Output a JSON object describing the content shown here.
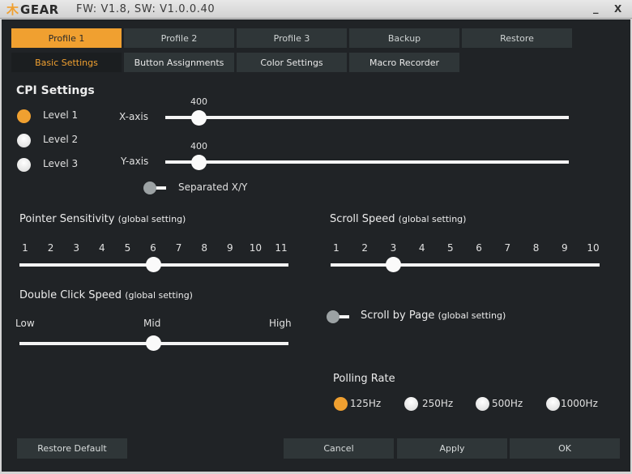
{
  "titlebar": {
    "logo_mark": "木",
    "logo_text": "GEAR",
    "version": "FW: V1.8, SW: V1.0.0.40",
    "minimize": "_",
    "close": "X"
  },
  "profile_tabs": [
    {
      "label": "Profile 1",
      "active": true
    },
    {
      "label": "Profile 2",
      "active": false
    },
    {
      "label": "Profile 3",
      "active": false
    },
    {
      "label": "Backup",
      "active": false
    },
    {
      "label": "Restore",
      "active": false
    }
  ],
  "sub_tabs": [
    {
      "label": "Basic Settings",
      "active": true
    },
    {
      "label": "Button Assignments",
      "active": false
    },
    {
      "label": "Color Settings",
      "active": false
    },
    {
      "label": "Macro Recorder",
      "active": false
    }
  ],
  "cpi": {
    "title": "CPI Settings",
    "levels": [
      {
        "label": "Level 1",
        "selected": true
      },
      {
        "label": "Level 2",
        "selected": false
      },
      {
        "label": "Level 3",
        "selected": false
      }
    ],
    "x_axis": {
      "label": "X-axis",
      "value": "400",
      "fraction": 0.08
    },
    "y_axis": {
      "label": "Y-axis",
      "value": "400",
      "fraction": 0.08
    },
    "separated_label": "Separated X/Y",
    "separated_on": false
  },
  "pointer": {
    "title": "Pointer Sensitivity",
    "note": "(global setting)",
    "ticks": [
      "1",
      "2",
      "3",
      "4",
      "5",
      "6",
      "7",
      "8",
      "9",
      "10",
      "11"
    ],
    "value": 6
  },
  "double_click": {
    "title": "Double Click Speed",
    "note": "(global setting)",
    "labels": {
      "low": "Low",
      "mid": "Mid",
      "high": "High"
    },
    "value": "Mid"
  },
  "scroll_speed": {
    "title": "Scroll Speed",
    "note": "(global setting)",
    "ticks": [
      "1",
      "2",
      "3",
      "4",
      "5",
      "6",
      "7",
      "8",
      "9",
      "10"
    ],
    "value": 3
  },
  "scroll_page": {
    "label": "Scroll by Page",
    "note": "(global setting)",
    "on": false
  },
  "polling": {
    "title": "Polling Rate",
    "options": [
      {
        "label": "125Hz",
        "selected": true
      },
      {
        "label": "250Hz",
        "selected": false
      },
      {
        "label": "500Hz",
        "selected": false
      },
      {
        "label": "1000Hz",
        "selected": false
      }
    ]
  },
  "footer": {
    "restore_default": "Restore Default",
    "cancel": "Cancel",
    "apply": "Apply",
    "ok": "OK"
  },
  "colors": {
    "accent": "#f0a030",
    "background": "#202326",
    "button": "#2f3638"
  }
}
